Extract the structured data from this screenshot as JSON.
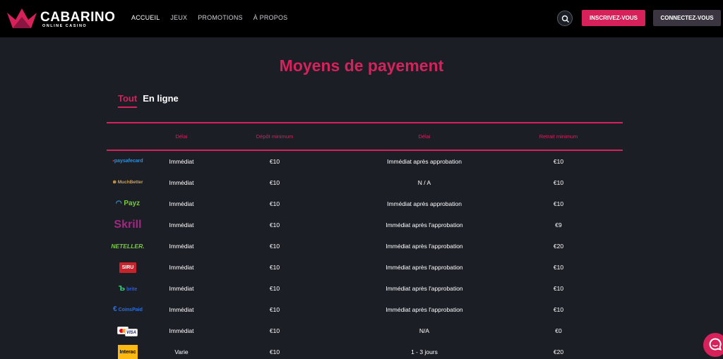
{
  "brand": {
    "name": "CABARINO",
    "tagline": "ONLINE CASINO",
    "accent": "#d6215b"
  },
  "nav": [
    {
      "label": "ACCUEIL",
      "active": true
    },
    {
      "label": "JEUX",
      "active": false
    },
    {
      "label": "PROMOTIONS",
      "active": false
    },
    {
      "label": "À PROPOS",
      "active": false
    }
  ],
  "header_actions": {
    "search_icon": "search-icon",
    "register_label": "INSCRIVEZ-VOUS",
    "login_label": "CONNECTEZ-VOUS"
  },
  "page_title": "Moyens de payement",
  "tabs": [
    {
      "label": "Tout",
      "active": true
    },
    {
      "label": "En ligne",
      "active": false
    }
  ],
  "table": {
    "headers": [
      "Délai",
      "Dépôt minimum",
      "Délai",
      "Retrait minimum"
    ],
    "rows": [
      {
        "method": "paysafecard",
        "deposit_delay": "Immédiat",
        "min_deposit": "€10",
        "withdraw_delay": "Immédiat après approbation",
        "min_withdraw": "€10"
      },
      {
        "method": "MuchBetter",
        "deposit_delay": "Immédiat",
        "min_deposit": "€10",
        "withdraw_delay": "N / A",
        "min_withdraw": "€10"
      },
      {
        "method": "Payz",
        "deposit_delay": "Immédiat",
        "min_deposit": "€10",
        "withdraw_delay": "Immédiat après approbation",
        "min_withdraw": "€10"
      },
      {
        "method": "Skrill",
        "deposit_delay": "Immédiat",
        "min_deposit": "€10",
        "withdraw_delay": "Immédiat après l'approbation",
        "min_withdraw": "€9"
      },
      {
        "method": "NETELLER",
        "deposit_delay": "Immédiat",
        "min_deposit": "€10",
        "withdraw_delay": "Immédiat après l'approbation",
        "min_withdraw": "€20"
      },
      {
        "method": "SIRU",
        "deposit_delay": "Immédiat",
        "min_deposit": "€10",
        "withdraw_delay": "Immédiat après l'approbation",
        "min_withdraw": "€10"
      },
      {
        "method": "Brite",
        "deposit_delay": "Immédiat",
        "min_deposit": "€10",
        "withdraw_delay": "Immédiat après l'approbation",
        "min_withdraw": "€10"
      },
      {
        "method": "CoinsPaid",
        "deposit_delay": "Immédiat",
        "min_deposit": "€10",
        "withdraw_delay": "Immédiat après l'approbation",
        "min_withdraw": "€10"
      },
      {
        "method": "VISA",
        "deposit_delay": "Immédiat",
        "min_deposit": "€10",
        "withdraw_delay": "N/A",
        "min_withdraw": "€0"
      },
      {
        "method": "Interac",
        "deposit_delay": "Varie",
        "min_deposit": "€10",
        "withdraw_delay": "1 - 3 jours",
        "min_withdraw": "€20"
      }
    ]
  },
  "chat_icon": "chat-icon"
}
